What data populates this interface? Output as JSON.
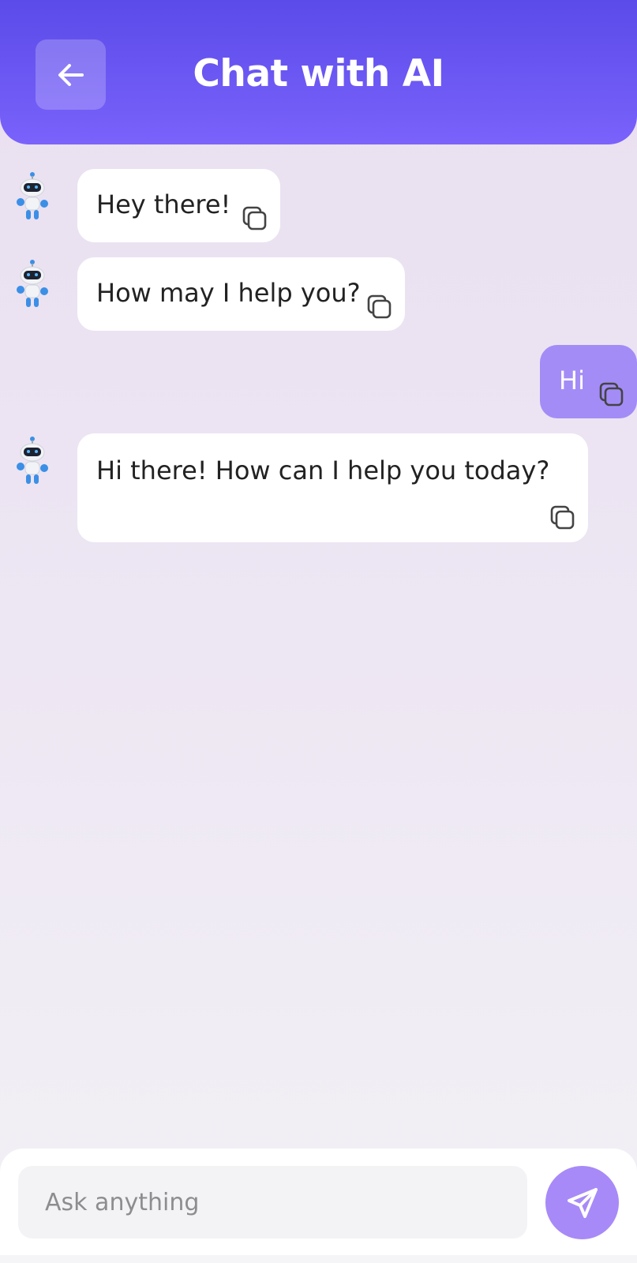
{
  "header": {
    "title": "Chat with AI",
    "back_icon": "arrow-left-icon"
  },
  "messages": [
    {
      "sender": "bot",
      "text": "Hey there!"
    },
    {
      "sender": "bot",
      "text": "How may I help you?"
    },
    {
      "sender": "user",
      "text": "Hi"
    },
    {
      "sender": "bot",
      "text": "Hi there! How can I help you today?"
    }
  ],
  "composer": {
    "placeholder": "Ask anything",
    "value": "",
    "send_icon": "send-icon"
  },
  "colors": {
    "header_top": "#5b4be9",
    "header_bottom": "#7a62fb",
    "user_bubble": "#a48cf7",
    "send_button": "#a78af7"
  }
}
